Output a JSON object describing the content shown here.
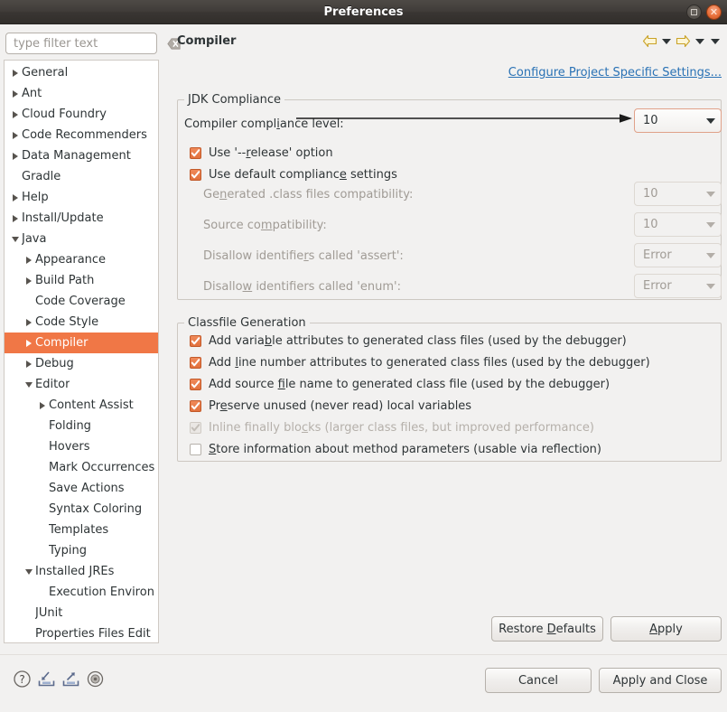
{
  "window": {
    "title": "Preferences",
    "maximize_label": "Maximize",
    "close_label": "Close"
  },
  "filter": {
    "placeholder": "type filter text",
    "value": "",
    "clear_icon": "clear-text-icon"
  },
  "tree": {
    "selected": "Compiler",
    "items": [
      {
        "label": "General",
        "indent": 0,
        "state": "collapsed"
      },
      {
        "label": "Ant",
        "indent": 0,
        "state": "collapsed"
      },
      {
        "label": "Cloud Foundry",
        "indent": 0,
        "state": "collapsed"
      },
      {
        "label": "Code Recommenders",
        "indent": 0,
        "state": "collapsed"
      },
      {
        "label": "Data Management",
        "indent": 0,
        "state": "collapsed"
      },
      {
        "label": "Gradle",
        "indent": 0,
        "state": "leaf"
      },
      {
        "label": "Help",
        "indent": 0,
        "state": "collapsed"
      },
      {
        "label": "Install/Update",
        "indent": 0,
        "state": "collapsed"
      },
      {
        "label": "Java",
        "indent": 0,
        "state": "expanded"
      },
      {
        "label": "Appearance",
        "indent": 1,
        "state": "collapsed"
      },
      {
        "label": "Build Path",
        "indent": 1,
        "state": "collapsed"
      },
      {
        "label": "Code Coverage",
        "indent": 1,
        "state": "leaf"
      },
      {
        "label": "Code Style",
        "indent": 1,
        "state": "collapsed"
      },
      {
        "label": "Compiler",
        "indent": 1,
        "state": "collapsed",
        "selected": true
      },
      {
        "label": "Debug",
        "indent": 1,
        "state": "collapsed"
      },
      {
        "label": "Editor",
        "indent": 1,
        "state": "expanded"
      },
      {
        "label": "Content Assist",
        "indent": 2,
        "state": "collapsed"
      },
      {
        "label": "Folding",
        "indent": 2,
        "state": "leaf"
      },
      {
        "label": "Hovers",
        "indent": 2,
        "state": "leaf"
      },
      {
        "label": "Mark Occurrences",
        "indent": 2,
        "state": "leaf"
      },
      {
        "label": "Save Actions",
        "indent": 2,
        "state": "leaf"
      },
      {
        "label": "Syntax Coloring",
        "indent": 2,
        "state": "leaf"
      },
      {
        "label": "Templates",
        "indent": 2,
        "state": "leaf"
      },
      {
        "label": "Typing",
        "indent": 2,
        "state": "leaf"
      },
      {
        "label": "Installed JREs",
        "indent": 1,
        "state": "expanded"
      },
      {
        "label": "Execution Environ",
        "indent": 2,
        "state": "leaf"
      },
      {
        "label": "JUnit",
        "indent": 1,
        "state": "leaf"
      },
      {
        "label": "Properties Files Edit",
        "indent": 1,
        "state": "leaf"
      }
    ]
  },
  "header": {
    "page_title": "Compiler",
    "back_icon": "back-arrow-icon",
    "forward_icon": "forward-arrow-icon",
    "dropdown_icon": "chevron-down-icon",
    "project_link": "Configure Project Specific Settings..."
  },
  "jdk_compliance": {
    "group_title": "JDK Compliance",
    "compliance_level": {
      "label": "Compiler compliance level:",
      "label_pre": "Compiler compl",
      "label_mn": "i",
      "label_post": "ance level:",
      "value": "10",
      "enabled": true
    },
    "checkboxes": [
      {
        "pre": "Use '--",
        "mn": "r",
        "post": "elease' option",
        "checked": true,
        "enabled": true
      },
      {
        "pre": "Use default complianc",
        "mn": "e",
        "post": " settings",
        "checked": true,
        "enabled": true
      }
    ],
    "disabled_fields": [
      {
        "pre": "Ge",
        "mn": "n",
        "post": "erated .class files compatibility:",
        "value": "10"
      },
      {
        "pre": "Source co",
        "mn": "m",
        "post": "patibility:",
        "value": "10"
      },
      {
        "pre": "Disallow identifie",
        "mn": "r",
        "post": "s called 'assert':",
        "value": "Error"
      },
      {
        "pre": "Disallo",
        "mn": "w",
        "post": " identifiers called 'enum':",
        "value": "Error"
      }
    ]
  },
  "classfile_generation": {
    "group_title": "Classfile Generation",
    "checkboxes": [
      {
        "pre": "Add varia",
        "mn": "b",
        "post": "le attributes to generated class files (used by the debugger)",
        "checked": true,
        "enabled": true
      },
      {
        "pre": "Add ",
        "mn": "l",
        "post": "ine number attributes to generated class files (used by the debugger)",
        "checked": true,
        "enabled": true
      },
      {
        "pre": "Add source ",
        "mn": "f",
        "post": "ile name to generated class file (used by the debugger)",
        "checked": true,
        "enabled": true
      },
      {
        "pre": "Pr",
        "mn": "e",
        "post": "serve unused (never read) local variables",
        "checked": true,
        "enabled": true
      },
      {
        "pre": "Inline finally blo",
        "mn": "c",
        "post": "ks (larger class files, but improved performance)",
        "checked": true,
        "enabled": false
      },
      {
        "pre": "",
        "mn": "S",
        "post": "tore information about method parameters (usable via reflection)",
        "checked": false,
        "enabled": true
      }
    ]
  },
  "buttons": {
    "restore_defaults": {
      "pre": "Restore ",
      "mn": "D",
      "post": "efaults"
    },
    "apply": {
      "pre": "",
      "mn": "A",
      "post": "pply"
    },
    "cancel": "Cancel",
    "apply_and_close": "Apply and Close"
  },
  "bottom_icons": [
    {
      "name": "help-icon",
      "title": "Help"
    },
    {
      "name": "import-preferences-icon",
      "title": "Import preferences"
    },
    {
      "name": "export-preferences-icon",
      "title": "Export preferences"
    },
    {
      "name": "settings-target-icon",
      "title": "Settings"
    }
  ],
  "colors": {
    "selection": "#f07746",
    "checkbox_on": "#e2703c",
    "link": "#2a72b5",
    "titlebar": "#3a3633",
    "background": "#f2f1f0"
  }
}
